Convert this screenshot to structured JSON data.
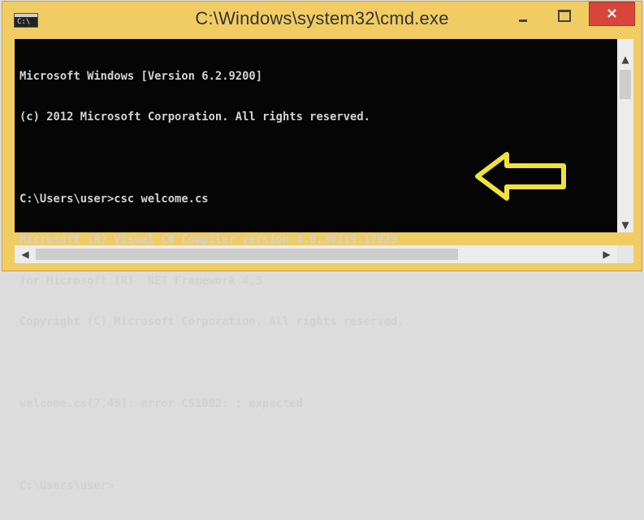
{
  "window": {
    "title": "C:\\Windows\\system32\\cmd.exe",
    "icon_text": "C:\\",
    "controls": {
      "minimize": "minimize",
      "maximize": "maximize",
      "close": "×"
    }
  },
  "console": {
    "lines": [
      "Microsoft Windows [Version 6.2.9200]",
      "(c) 2012 Microsoft Corporation. All rights reserved.",
      "",
      "C:\\Users\\user>csc welcome.cs",
      "Microsoft (R) Visual C# Compiler version 4.0.30319.17929",
      "for Microsoft (R) .NET Framework 4.5",
      "Copyright (C) Microsoft Corporation. All rights reserved.",
      "",
      "welcome.cs(7,45): error CS1002: ; expected",
      "",
      "C:\\Users\\user>"
    ],
    "text_color": "#d2d2d2",
    "background": "#050505"
  },
  "scrollbars": {
    "up": "▲",
    "down": "▼",
    "left": "◀",
    "right": "▶"
  },
  "annotation": {
    "arrow_color": "#f0e23a",
    "arrow_icon": "left-arrow-icon"
  },
  "colors": {
    "frame": "#f1cc63",
    "close_button": "#d8453b"
  }
}
